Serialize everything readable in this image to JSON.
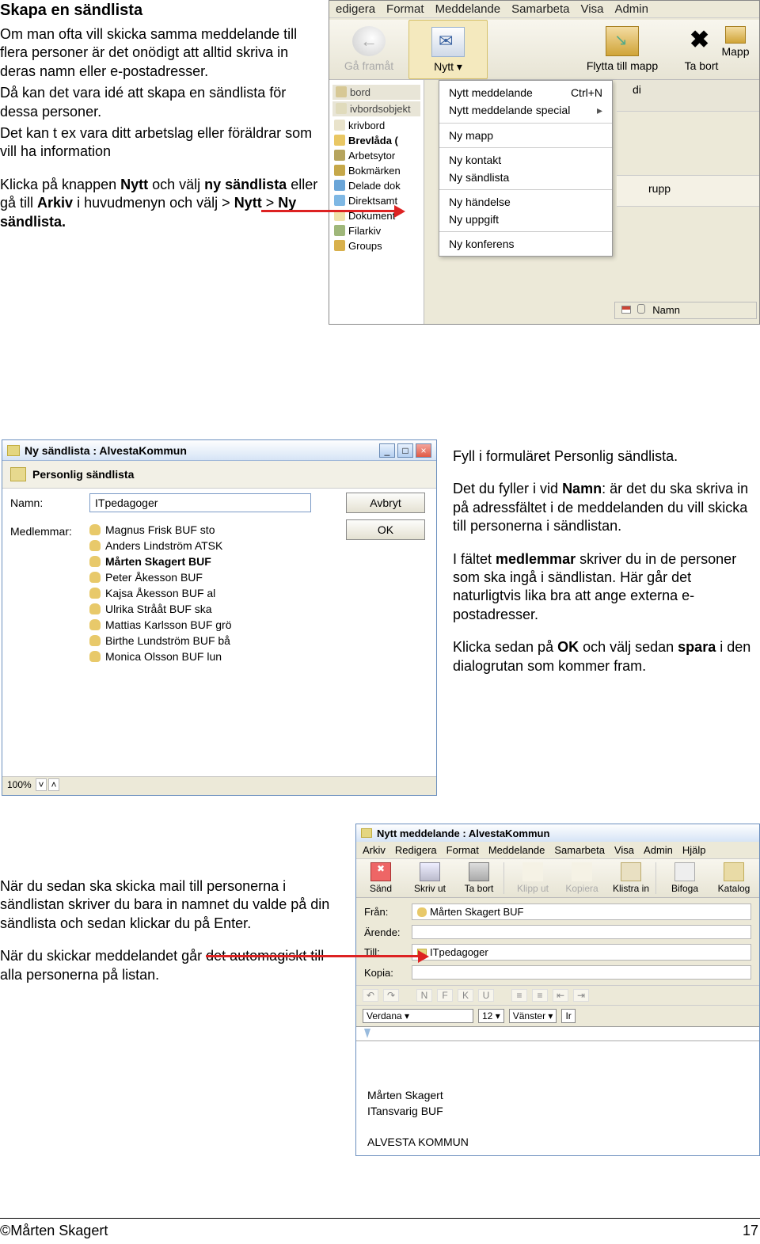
{
  "heading": "Skapa en sändlista",
  "intro": {
    "p1": "Om man ofta vill skicka samma meddelande till flera personer är det onödigt att alltid skriva in deras namn eller e-postadresser.",
    "p2": "Då kan det vara idé att skapa en sändlista för dessa personer.",
    "p3": "Det kan t ex vara ditt arbetslag eller föräldrar som vill ha information",
    "p4a": "Klicka på knappen ",
    "p4b": " och välj ",
    "p4c": " eller gå till ",
    "p4d": " i huvudmenyn och välj > ",
    "p4e": " > ",
    "bold_nytt": "Nytt",
    "bold_ny_sandlista": "ny sändlista",
    "bold_arkiv": "Arkiv",
    "bold_nytt2": "Nytt",
    "bold_ny_sandlista2": "Ny sändlista."
  },
  "mid": {
    "p1": "Fyll i formuläret Personlig sändlista.",
    "p2a": "Det du fyller i vid ",
    "p2_bold": "Namn",
    "p2b": ": är det du ska skriva in på adressfältet i de meddelanden du vill skicka till personerna i sändlistan.",
    "p3a": "I fältet ",
    "p3_bold": "medlemmar",
    "p3b": " skriver du in de personer som ska ingå i sändlistan. Här går det naturligtvis lika bra att ange externa e-postadresser.",
    "p4a": "Klicka sedan på ",
    "p4_bold1": "OK",
    "p4b": " och välj sedan ",
    "p4_bold2": "spara",
    "p4c": " i den dialogrutan som kommer fram."
  },
  "bottom": {
    "p1": "När du sedan ska skicka mail till personerna i sändlistan skriver du bara in namnet du valde på din sändlista och sedan klickar du på Enter.",
    "p2": "När du skickar meddelandet går det automagiskt till alla personerna på listan."
  },
  "footer": {
    "author": "©Mårten Skagert",
    "page": "17"
  },
  "sc1": {
    "menu": [
      "edigera",
      "Format",
      "Meddelande",
      "Samarbeta",
      "Visa",
      "Admin"
    ],
    "tb": {
      "ga": "Gå framåt",
      "nytt": "Nytt",
      "flytta": "Flytta till mapp",
      "tabort": "Ta bort",
      "mapp": "Mapp"
    },
    "side": {
      "bord": "bord",
      "obj": "ivbordsobjekt",
      "skriv": "krivbord",
      "brev": "Brevlåda (",
      "arb": "Arbetsytor",
      "bok": "Bokmärken",
      "del": "Delade dok",
      "dir": "Direktsamt",
      "dok": "Dokument",
      "fil": "Filarkiv",
      "grp": "Groups"
    },
    "drop": {
      "nytt_medd": "Nytt meddelande",
      "shortcut": "Ctrl+N",
      "nytt_spec": "Nytt meddelande special",
      "ny_mapp": "Ny mapp",
      "ny_kontakt": "Ny kontakt",
      "ny_sandlista": "Ny sändlista",
      "ny_handelse": "Ny händelse",
      "ny_uppgift": "Ny uppgift",
      "ny_konferens": "Ny konferens"
    },
    "di": "di",
    "rupp": "rupp",
    "namn": "Namn"
  },
  "sc2": {
    "title": "Ny sändlista : AlvestaKommun",
    "hdr": "Personlig sändlista",
    "lbl_namn": "Namn:",
    "val_namn": "ITpedagoger",
    "lbl_medl": "Medlemmar:",
    "members": [
      "Magnus Frisk BUF sto",
      "Anders Lindström ATSK",
      "Mårten Skagert BUF",
      "Peter Åkesson BUF",
      "Kajsa Åkesson BUF al",
      "Ulrika Strååt BUF ska",
      "Mattias Karlsson BUF grö",
      "Birthe Lundström BUF bå",
      "Monica Olsson BUF lun"
    ],
    "btn_avbryt": "Avbryt",
    "btn_ok": "OK",
    "zoom": "100%"
  },
  "sc3": {
    "title": "Nytt meddelande : AlvestaKommun",
    "menu": [
      "Arkiv",
      "Redigera",
      "Format",
      "Meddelande",
      "Samarbeta",
      "Visa",
      "Admin",
      "Hjälp"
    ],
    "tb": {
      "sand": "Sänd",
      "skriv": "Skriv ut",
      "tabort": "Ta bort",
      "klipp": "Klipp ut",
      "kopiera": "Kopiera",
      "klistra": "Klistra in",
      "bifoga": "Bifoga",
      "katalog": "Katalog"
    },
    "fields": {
      "fran_lbl": "Från:",
      "fran_val": "Mårten Skagert BUF",
      "arende_lbl": "Ärende:",
      "till_lbl": "Till:",
      "till_val": "ITpedagoger",
      "kopia_lbl": "Kopia:"
    },
    "fmt": [
      "N",
      "F",
      "K",
      "U"
    ],
    "font": "Verdana",
    "size": "12",
    "align": "Vänster",
    "sig1": "Mårten Skagert",
    "sig2": "ITansvarig BUF",
    "sig3": "ALVESTA KOMMUN"
  }
}
